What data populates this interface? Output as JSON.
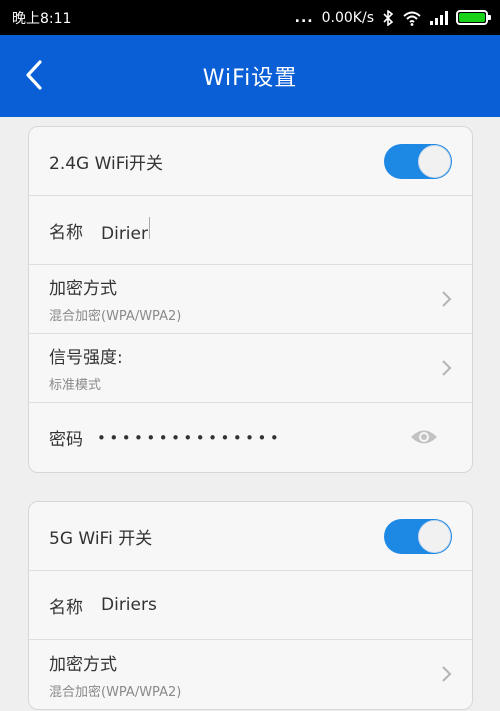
{
  "status_bar": {
    "time": "晚上8:11",
    "signal_dots": "...",
    "speed": "0.00K/s",
    "icons": [
      "bluetooth-icon",
      "wifi-icon",
      "cell-signal-icon",
      "battery-icon"
    ],
    "battery_color": "#19d219"
  },
  "appbar": {
    "title": "WiFi设置",
    "background": "#0a5fd6"
  },
  "wifi24": {
    "switch_label": "2.4G WiFi开关",
    "switch_on": true,
    "name_label": "名称",
    "name_value": "Dirier",
    "encryption_label": "加密方式",
    "encryption_value": "混合加密(WPA/WPA2)",
    "signal_label": "信号强度:",
    "signal_value": "标准模式",
    "password_label": "密码",
    "password_masked": "•••••••••••••••"
  },
  "wifi5": {
    "switch_label": "5G WiFi 开关",
    "switch_on": true,
    "name_label": "名称",
    "name_value": "Diriers",
    "encryption_label": "加密方式",
    "encryption_value": "混合加密(WPA/WPA2)"
  },
  "colors": {
    "toggle_on": "#1e88e5"
  }
}
